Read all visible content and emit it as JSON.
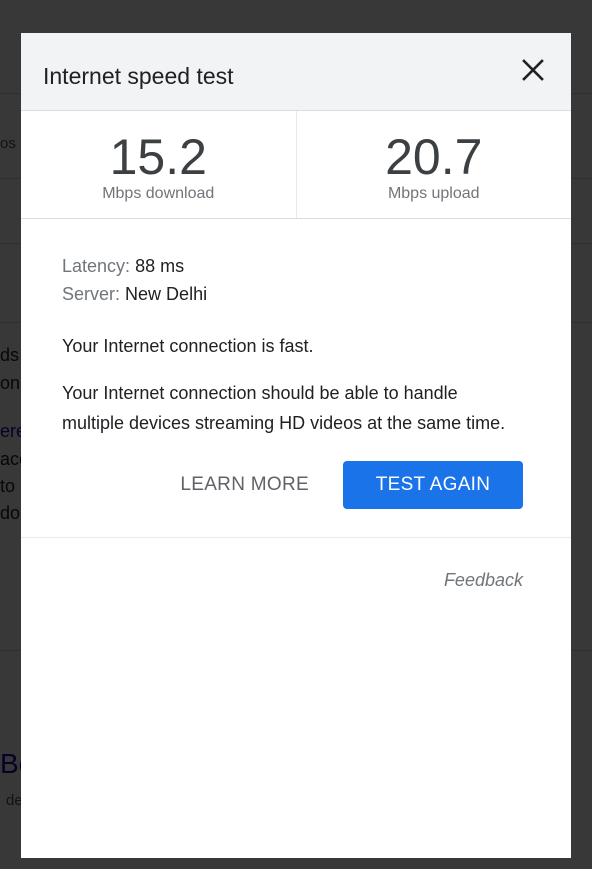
{
  "background": {
    "fragments": [
      "os",
      "ds",
      "on",
      "ere",
      "acc",
      "to",
      "do",
      "Be",
      "de"
    ]
  },
  "dialog": {
    "title": "Internet speed test",
    "close_icon": "close-icon",
    "download": {
      "value": "15.2",
      "label": "Mbps download"
    },
    "upload": {
      "value": "20.7",
      "label": "Mbps upload"
    },
    "latency": {
      "label": "Latency:",
      "value": "88 ms"
    },
    "server": {
      "label": "Server:",
      "value": "New Delhi"
    },
    "summary": "Your Internet connection is fast.",
    "description": "Your Internet connection should be able to handle multiple devices streaming HD videos at the same time.",
    "learn_more_label": "LEARN MORE",
    "test_again_label": "TEST AGAIN",
    "feedback_label": "Feedback"
  },
  "colors": {
    "accent": "#1a73e8",
    "header_bg": "#f1f3f4",
    "overlay": "#3a3a3a"
  }
}
